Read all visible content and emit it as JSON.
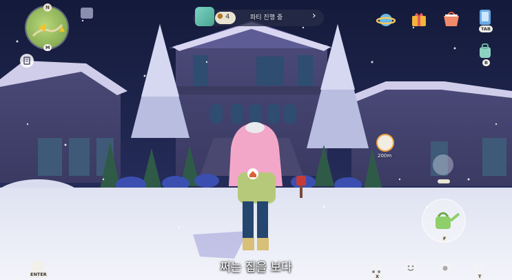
{
  "party": {
    "member_count": "4",
    "status_text": "파티 진행 중"
  },
  "subtitle": "쩌는 집을 보다",
  "hotkeys": {
    "chat": "ENTER",
    "vehicle": "X",
    "tab_menu": "TAB",
    "bag": "B",
    "map": "M",
    "camera_t": "T",
    "watering": "F"
  },
  "waypoint": {
    "distance": "200m"
  },
  "icons": {
    "top_right": [
      "planet-icon",
      "gift-icon",
      "shop-basket-icon",
      "phone-menu-icon"
    ],
    "bottom_right": [
      "car-icon",
      "emote-smiley-icon",
      "camera-icon",
      "table-icon"
    ],
    "left": [
      "minimap-icon",
      "quest-list-icon",
      "chat-bubble-icon"
    ],
    "action": [
      "watering-can-icon",
      "dance-pose-icon",
      "home-marker-icon"
    ]
  },
  "colors": {
    "sky": "#1e2347",
    "snow": "#eef0f7",
    "house_wall": "#4b4a78",
    "roof_snow": "#d6d4ef",
    "character_hair": "#f2a7c9"
  }
}
